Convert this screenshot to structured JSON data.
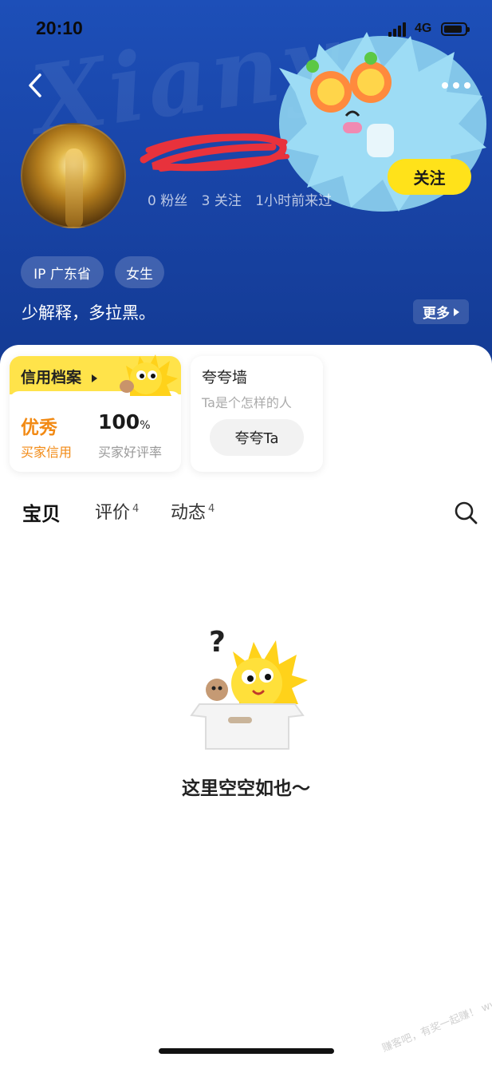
{
  "status_bar": {
    "time": "20:10",
    "network": "4G"
  },
  "profile": {
    "follow_label": "关注",
    "stats": {
      "fans": "0 粉丝",
      "following": "3 关注",
      "last_seen": "1小时前来过"
    },
    "tags": {
      "ip": "IP 广东省",
      "gender": "女生"
    },
    "bio": "少解释，多拉黑。",
    "bio_more_label": "更多"
  },
  "credit_card": {
    "title": "信用档案",
    "level": "优秀",
    "level_label": "买家信用",
    "rate_value": "100",
    "rate_unit": "%",
    "rate_label": "买家好评率"
  },
  "praise_card": {
    "title": "夸夸墙",
    "subtitle": "Ta是个怎样的人",
    "button_label": "夸夸Ta"
  },
  "tabs": [
    {
      "label": "宝贝",
      "count": ""
    },
    {
      "label": "评价",
      "count": "4"
    },
    {
      "label": "动态",
      "count": "4"
    }
  ],
  "empty_state": {
    "text": "这里空空如也～"
  },
  "icons": {
    "back": "chevron-left-icon",
    "more": "more-horizontal-icon",
    "search": "search-icon"
  },
  "colors": {
    "header_blue": "#1945a8",
    "accent_yellow": "#ffe21a",
    "credit_orange": "#f28a14"
  }
}
